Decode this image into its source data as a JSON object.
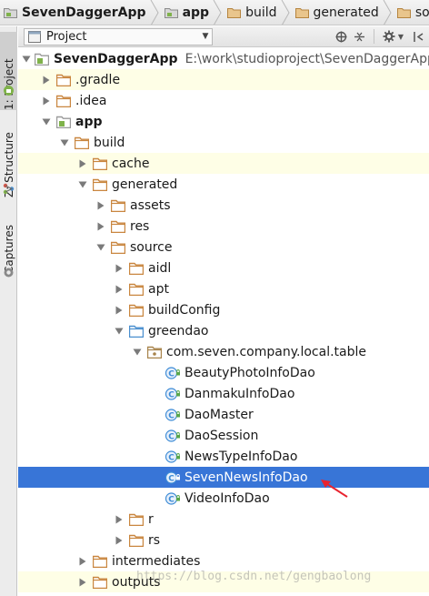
{
  "breadcrumbs": [
    {
      "label": "SevenDaggerApp",
      "bold": true
    },
    {
      "label": "app",
      "bold": true
    },
    {
      "label": "build",
      "bold": false
    },
    {
      "label": "generated",
      "bold": false
    },
    {
      "label": "source",
      "bold": false
    }
  ],
  "side_tabs": {
    "project": "1: Project",
    "structure": "Z: Structure",
    "captures": "Captures"
  },
  "panel": {
    "view_select": "Project"
  },
  "tree": [
    {
      "label": "SevenDaggerApp",
      "path": "E:\\work\\studioproject\\SevenDaggerApp",
      "depth": 0,
      "arrow": "open",
      "icon": "module-folder-icon",
      "bold": true
    },
    {
      "label": ".gradle",
      "depth": 1,
      "arrow": "closed",
      "icon": "folder-icon",
      "highlight": true
    },
    {
      "label": ".idea",
      "depth": 1,
      "arrow": "closed",
      "icon": "folder-icon"
    },
    {
      "label": "app",
      "depth": 1,
      "arrow": "open",
      "icon": "module-folder-icon",
      "bold": true
    },
    {
      "label": "build",
      "depth": 2,
      "arrow": "open",
      "icon": "folder-icon"
    },
    {
      "label": "cache",
      "depth": 3,
      "arrow": "closed",
      "icon": "folder-icon",
      "highlight": true
    },
    {
      "label": "generated",
      "depth": 3,
      "arrow": "open",
      "icon": "folder-icon"
    },
    {
      "label": "assets",
      "depth": 4,
      "arrow": "closed",
      "icon": "folder-icon"
    },
    {
      "label": "res",
      "depth": 4,
      "arrow": "closed",
      "icon": "folder-icon"
    },
    {
      "label": "source",
      "depth": 4,
      "arrow": "open",
      "icon": "folder-icon"
    },
    {
      "label": "aidl",
      "depth": 5,
      "arrow": "closed",
      "icon": "folder-icon"
    },
    {
      "label": "apt",
      "depth": 5,
      "arrow": "closed",
      "icon": "folder-icon"
    },
    {
      "label": "buildConfig",
      "depth": 5,
      "arrow": "closed",
      "icon": "folder-icon"
    },
    {
      "label": "greendao",
      "depth": 5,
      "arrow": "open",
      "icon": "source-folder-icon"
    },
    {
      "label": "com.seven.company.local.table",
      "depth": 6,
      "arrow": "open",
      "icon": "package-icon"
    },
    {
      "label": "BeautyPhotoInfoDao",
      "depth": 7,
      "arrow": "none",
      "icon": "class-icon"
    },
    {
      "label": "DanmakuInfoDao",
      "depth": 7,
      "arrow": "none",
      "icon": "class-icon"
    },
    {
      "label": "DaoMaster",
      "depth": 7,
      "arrow": "none",
      "icon": "class-icon"
    },
    {
      "label": "DaoSession",
      "depth": 7,
      "arrow": "none",
      "icon": "class-icon"
    },
    {
      "label": "NewsTypeInfoDao",
      "depth": 7,
      "arrow": "none",
      "icon": "class-icon"
    },
    {
      "label": "SevenNewsInfoDao",
      "depth": 7,
      "arrow": "none",
      "icon": "class-icon",
      "selected": true
    },
    {
      "label": "VideoInfoDao",
      "depth": 7,
      "arrow": "none",
      "icon": "class-icon"
    },
    {
      "label": "r",
      "depth": 5,
      "arrow": "closed",
      "icon": "folder-icon"
    },
    {
      "label": "rs",
      "depth": 5,
      "arrow": "closed",
      "icon": "folder-icon"
    },
    {
      "label": "intermediates",
      "depth": 3,
      "arrow": "closed",
      "icon": "folder-icon"
    },
    {
      "label": "outputs",
      "depth": 3,
      "arrow": "closed",
      "icon": "folder-icon",
      "highlight": true
    }
  ],
  "watermark": "https://blog.csdn.net/gengbaolong",
  "colors": {
    "selection": "#3875d7",
    "folder": "#c9863f",
    "source_folder": "#4a8fcf",
    "class_badge": "#3d8bd6",
    "highlight_row": "#fefee6"
  }
}
